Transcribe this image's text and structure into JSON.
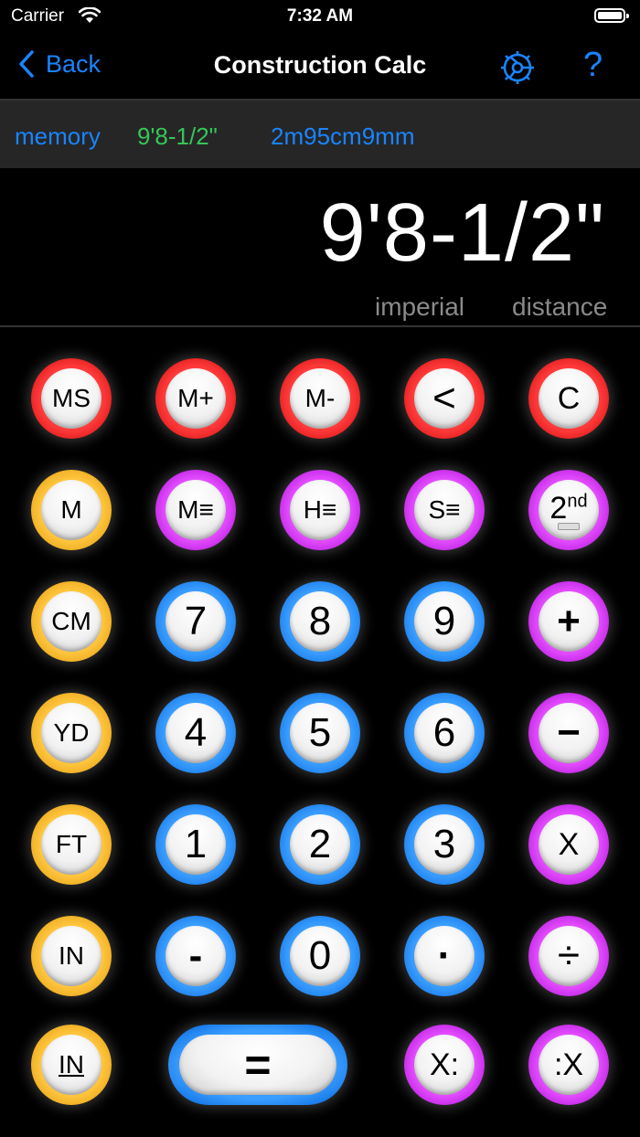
{
  "status": {
    "carrier": "Carrier",
    "time": "7:32 AM"
  },
  "nav": {
    "back_label": "Back",
    "title": "Construction Calc",
    "help_label": "?"
  },
  "memory": {
    "label": "memory",
    "imperial": "9'8-1/2\"",
    "metric": "2m95cm9mm"
  },
  "display": {
    "value": "9'8-1/2\"",
    "unit_system": "imperial",
    "mode": "distance"
  },
  "keys": {
    "ms": "MS",
    "mplus": "M+",
    "mminus": "M-",
    "back": "<",
    "clear": "C",
    "m": "M",
    "mlist": "M≡",
    "hlist": "H≡",
    "slist": "S≡",
    "second": "2",
    "second_sup": "nd",
    "cm": "CM",
    "seven": "7",
    "eight": "8",
    "nine": "9",
    "plus": "+",
    "yd": "YD",
    "four": "4",
    "five": "5",
    "six": "6",
    "minus": "−",
    "ft": "FT",
    "one": "1",
    "two": "2",
    "three": "3",
    "times": "X",
    "in": "IN",
    "neg": "-",
    "zero": "0",
    "dot": "·",
    "divide": "÷",
    "in_fraction": "IN",
    "equals": "=",
    "x_colon": "X:",
    "colon_x": ":X"
  },
  "colors": {
    "accent_blue": "#1a84ff",
    "memory_green": "#35c759",
    "ring_red": "#ff3b3b",
    "ring_orange": "#ffc53d",
    "ring_purple": "#e24bff",
    "ring_blue": "#3a9dff"
  }
}
